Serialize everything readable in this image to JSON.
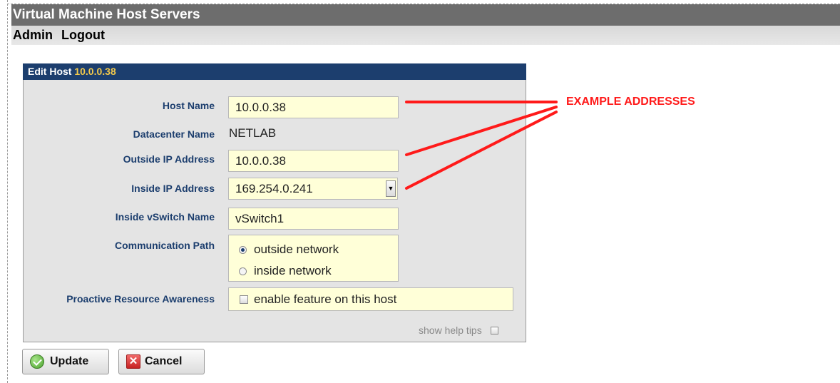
{
  "app": {
    "title": "Virtual Machine Host Servers",
    "menu": {
      "admin": "Admin",
      "logout": "Logout"
    }
  },
  "panel": {
    "heading_prefix": "Edit Host ",
    "heading_host": "10.0.0.38"
  },
  "form": {
    "host_name": {
      "label": "Host Name",
      "value": "10.0.0.38"
    },
    "datacenter_name": {
      "label": "Datacenter Name",
      "value": "NETLAB"
    },
    "outside_ip": {
      "label": "Outside IP Address",
      "value": "10.0.0.38"
    },
    "inside_ip": {
      "label": "Inside IP Address",
      "value": "169.254.0.241"
    },
    "inside_vswitch": {
      "label": "Inside vSwitch Name",
      "value": "vSwitch1"
    },
    "communication_path": {
      "label": "Communication Path",
      "options": [
        "outside network",
        "inside network"
      ],
      "selected": "outside network"
    },
    "proactive": {
      "label": "Proactive Resource Awareness",
      "checkbox_label": "enable feature on this host",
      "checked": false
    },
    "help_tips": {
      "label": "show help tips",
      "checked": false
    }
  },
  "buttons": {
    "update": "Update",
    "cancel": "Cancel"
  },
  "annotation": {
    "text": "EXAMPLE ADDRESSES",
    "color": "#ff1a1a"
  },
  "colors": {
    "titlebar": "#6d6d6d",
    "panel_header": "#1c3e6e",
    "label_text": "#1c3e6e",
    "input_bg": "#ffffd8",
    "host_highlight": "#f2c94c"
  }
}
